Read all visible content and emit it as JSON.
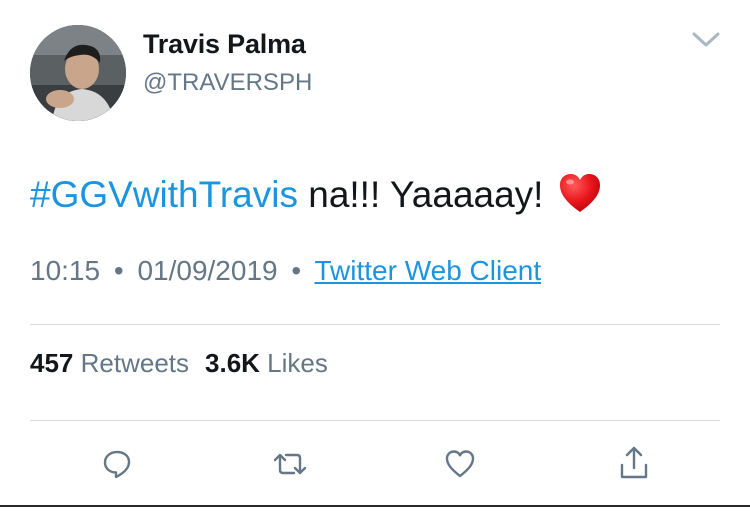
{
  "header": {
    "display_name": "Travis Palma",
    "handle": "@TRAVERSPH"
  },
  "tweet": {
    "hashtag": "#GGVwithTravis",
    "text": " na!!! Yaaaaay!",
    "emoji": "red-heart"
  },
  "meta": {
    "time": "10:15",
    "date": "01/09/2019",
    "separator": "•",
    "client": "Twitter Web Client"
  },
  "stats": {
    "retweets_count": "457",
    "retweets_label": "Retweets",
    "likes_count": "3.6K",
    "likes_label": "Likes"
  },
  "actions": [
    "reply-icon",
    "retweet-icon",
    "like-icon",
    "share-icon"
  ],
  "colors": {
    "link": "#1b95e0",
    "secondary_text": "#657786",
    "primary_text": "#14171a",
    "heart": "#e0245e"
  }
}
